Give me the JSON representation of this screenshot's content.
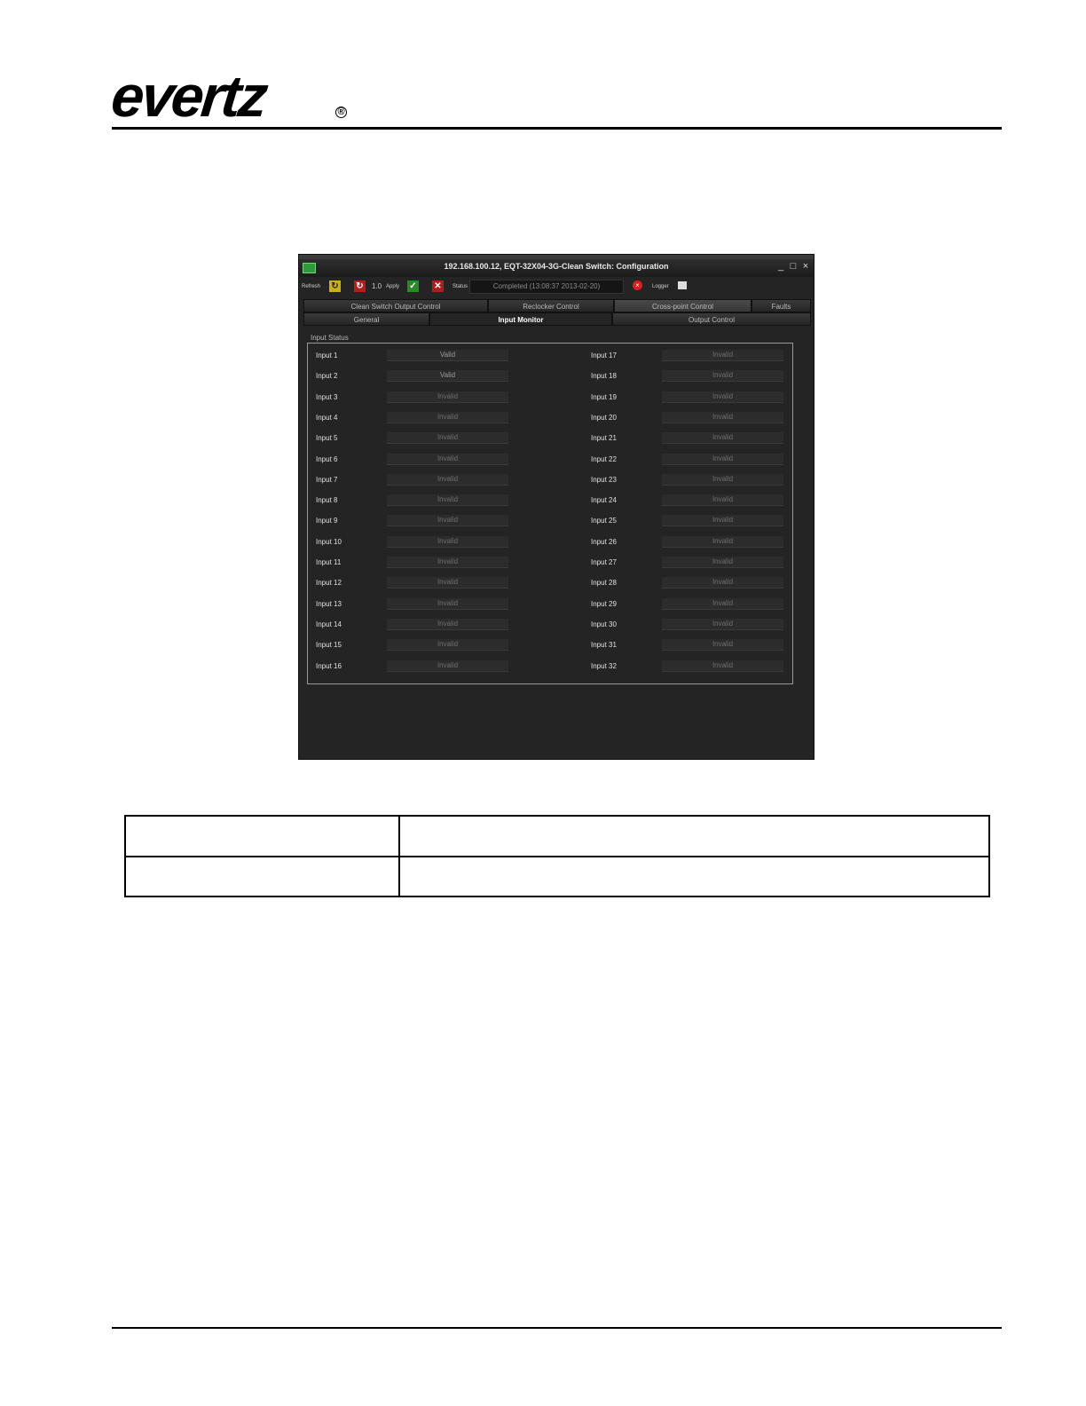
{
  "header": {
    "logo_text": "evertz",
    "logo_mark": "®"
  },
  "window": {
    "title": "192.168.100.12, EQT-32X04-3G-Clean Switch: Configuration",
    "controls": [
      "_",
      "□",
      "×"
    ]
  },
  "toolbar": {
    "refresh_label": "Refresh",
    "version": "1.0",
    "apply_label": "Apply",
    "status_label": "Status",
    "status_value": "Completed (13:08:37 2013-02-20)",
    "logger_label": "Logger"
  },
  "tabs_top": [
    "Clean Switch Output Control",
    "Reclocker Control",
    "Cross-point Control",
    "Faults"
  ],
  "tabs_bottom": [
    "General",
    "Input Monitor",
    "Output Control"
  ],
  "selected_tab": "Input Monitor",
  "input_status": {
    "title": "Input Status",
    "left": [
      {
        "label": "Input 1",
        "value": "Valid"
      },
      {
        "label": "Input 2",
        "value": "Valid"
      },
      {
        "label": "Input 3",
        "value": "Invalid"
      },
      {
        "label": "Input 4",
        "value": "Invalid"
      },
      {
        "label": "Input 5",
        "value": "Invalid"
      },
      {
        "label": "Input 6",
        "value": "Invalid"
      },
      {
        "label": "Input 7",
        "value": "Invalid"
      },
      {
        "label": "Input 8",
        "value": "Invalid"
      },
      {
        "label": "Input 9",
        "value": "Invalid"
      },
      {
        "label": "Input 10",
        "value": "Invalid"
      },
      {
        "label": "Input 11",
        "value": "Invalid"
      },
      {
        "label": "Input 12",
        "value": "Invalid"
      },
      {
        "label": "Input 13",
        "value": "Invalid"
      },
      {
        "label": "Input 14",
        "value": "Invalid"
      },
      {
        "label": "Input 15",
        "value": "Invalid"
      },
      {
        "label": "Input 16",
        "value": "Invalid"
      }
    ],
    "right": [
      {
        "label": "Input 17",
        "value": "Invalid"
      },
      {
        "label": "Input 18",
        "value": "Invalid"
      },
      {
        "label": "Input 19",
        "value": "Invalid"
      },
      {
        "label": "Input 20",
        "value": "Invalid"
      },
      {
        "label": "Input 21",
        "value": "Invalid"
      },
      {
        "label": "Input 22",
        "value": "Invalid"
      },
      {
        "label": "Input 23",
        "value": "Invalid"
      },
      {
        "label": "Input 24",
        "value": "Invalid"
      },
      {
        "label": "Input 25",
        "value": "Invalid"
      },
      {
        "label": "Input 26",
        "value": "Invalid"
      },
      {
        "label": "Input 27",
        "value": "Invalid"
      },
      {
        "label": "Input 28",
        "value": "Invalid"
      },
      {
        "label": "Input 29",
        "value": "Invalid"
      },
      {
        "label": "Input 30",
        "value": "Invalid"
      },
      {
        "label": "Input 31",
        "value": "Invalid"
      },
      {
        "label": "Input 32",
        "value": "Invalid"
      }
    ]
  },
  "table": {
    "rows": [
      [
        "",
        ""
      ],
      [
        "",
        ""
      ]
    ]
  }
}
